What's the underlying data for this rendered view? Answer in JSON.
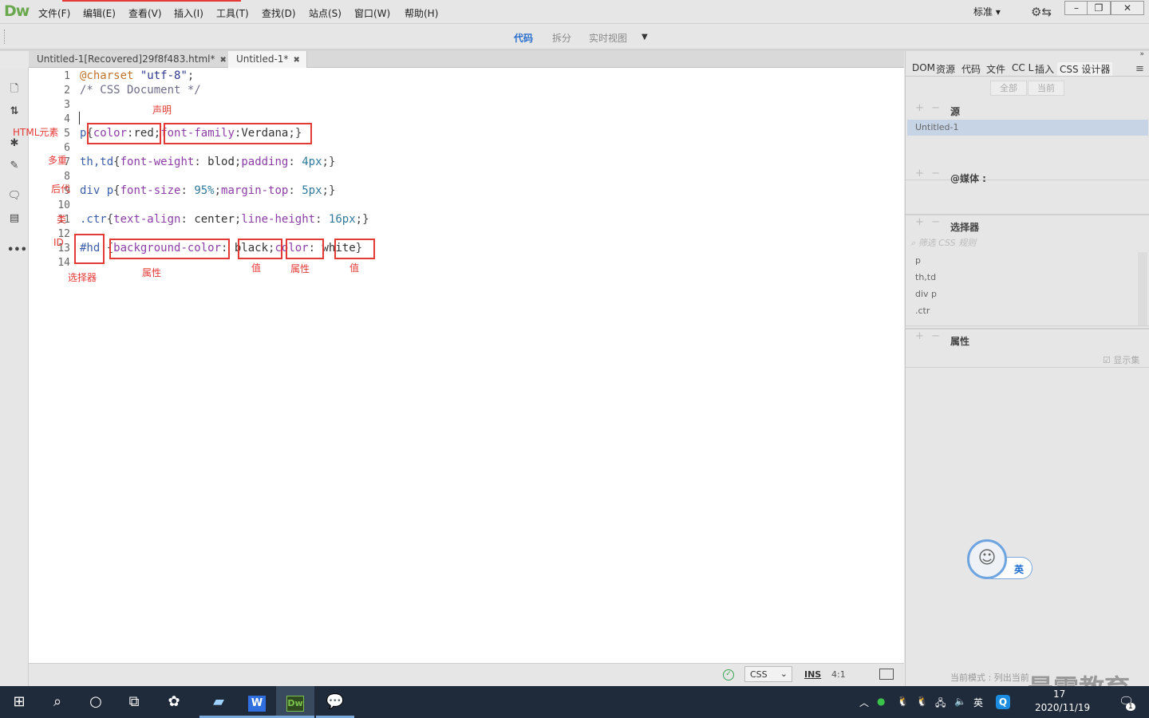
{
  "app": {
    "logo": "Dw"
  },
  "menu": [
    "文件(F)",
    "编辑(E)",
    "查看(V)",
    "插入(I)",
    "工具(T)",
    "查找(D)",
    "站点(S)",
    "窗口(W)",
    "帮助(H)"
  ],
  "workspace": {
    "layout_label": "标准",
    "settings_icon": "gear-sync-icon"
  },
  "window_buttons": [
    "minimize-icon",
    "restore-icon",
    "close-icon"
  ],
  "view_bar": {
    "code": "代码",
    "split": "拆分",
    "live": "实时视图"
  },
  "tabs": [
    {
      "label": "Untitled-1[Recovered]29f8f483.html*",
      "active": false
    },
    {
      "label": "Untitled-1*",
      "active": true
    }
  ],
  "code_lines": [
    {
      "num": "1",
      "text": "@charset \"utf-8\";"
    },
    {
      "num": "2",
      "text": "/* CSS Document */"
    },
    {
      "num": "3",
      "text": ""
    },
    {
      "num": "4",
      "text": ""
    },
    {
      "num": "5",
      "text": "p{color:red;font-family:Verdana;}"
    },
    {
      "num": "6",
      "text": ""
    },
    {
      "num": "7",
      "text": "th,td{font-weight: blod;padding: 4px;}"
    },
    {
      "num": "8",
      "text": ""
    },
    {
      "num": "9",
      "text": "div p{font-size: 95%;margin-top: 5px;}"
    },
    {
      "num": "10",
      "text": ""
    },
    {
      "num": "11",
      "text": ".ctr{text-align: center;line-height: 16px;}"
    },
    {
      "num": "12",
      "text": ""
    },
    {
      "num": "13",
      "text": "#hd {background-color: black;color: white}"
    },
    {
      "num": "14",
      "text": ""
    }
  ],
  "annotations": {
    "declaration": "声明",
    "html_element": "HTML元素",
    "multiple": "多重",
    "descendant": "后代",
    "class": "类",
    "id": "ID",
    "selector": "选择器",
    "property1": "属性",
    "value1": "值",
    "property2": "属性",
    "value2": "值"
  },
  "status": {
    "lang": "CSS",
    "mode": "INS",
    "position": "4:1"
  },
  "right_panel": {
    "tabs": [
      "DOM",
      "资源",
      "代码",
      "文件",
      "CC L",
      "插入",
      "CSS 设计器"
    ],
    "toggle_all": "全部",
    "toggle_current": "当前",
    "sources_title": "源",
    "source_item": "Untitled-1",
    "media_title": "@媒体 :",
    "selectors_title": "选择器",
    "filter_placeholder": "筛选 CSS 规则",
    "selectors": [
      "p",
      "th,td",
      "div p",
      ".ctr"
    ],
    "properties_title": "属性",
    "show_set": "显示集",
    "footer": "当前模式 : 列出当前"
  },
  "ime": {
    "label": "英"
  },
  "watermark": "最需教育",
  "taskbar": {
    "date": "2020/11/19",
    "time": "17",
    "lang": "英",
    "notif_count": "1"
  }
}
